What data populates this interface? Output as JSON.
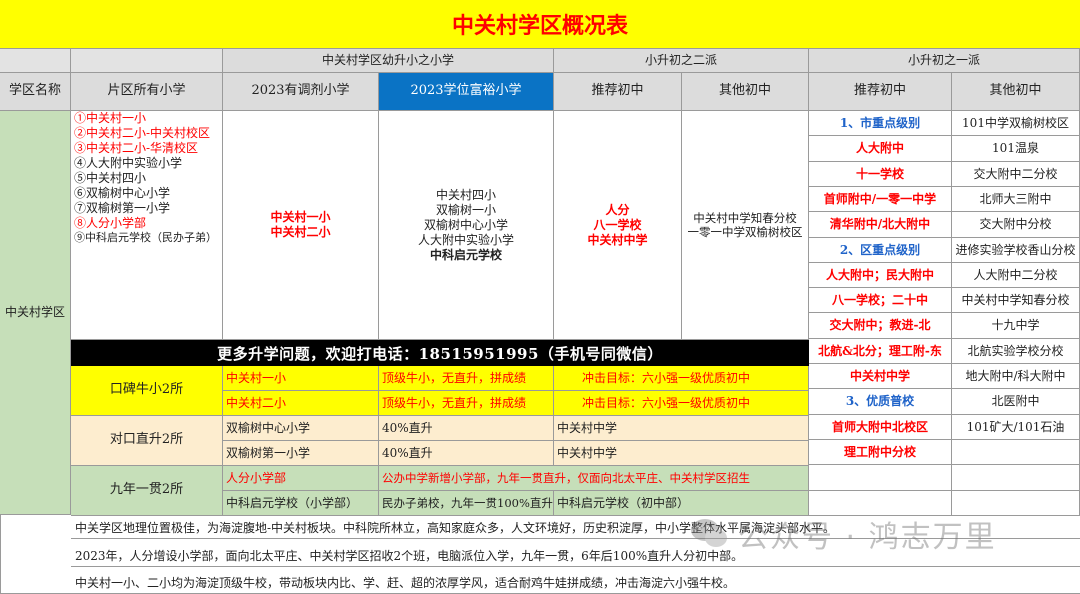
{
  "title": "中关村学区概况表",
  "headers": {
    "group_left": "中关村学区幼升小之小学",
    "group_mid": "小升初之二派",
    "group_right": "小升初之一派",
    "district_name": "学区名称",
    "all_schools": "片区所有小学",
    "adjust_2023": "2023有调剂小学",
    "rich_2023": "2023学位富裕小学",
    "rec_mid": "推荐初中",
    "other_mid": "其他初中",
    "rec_right": "推荐初中",
    "other_right": "其他初中"
  },
  "district": "中关村学区",
  "all_schools": [
    {
      "text": "①中关村一小",
      "red": true
    },
    {
      "text": "②中关村二小-中关村校区",
      "red": true
    },
    {
      "text": "③中关村二小-华清校区",
      "red": true
    },
    {
      "text": "④人大附中实验小学",
      "red": false
    },
    {
      "text": "⑤中关村四小",
      "red": false
    },
    {
      "text": "⑥双榆树中心小学",
      "red": false
    },
    {
      "text": "⑦双榆树第一小学",
      "red": false
    },
    {
      "text": "⑧人分小学部",
      "red": true
    },
    {
      "text": "⑨中科启元学校（民办子弟）",
      "red": false
    }
  ],
  "adjust_schools": [
    "中关村一小",
    "中关村二小"
  ],
  "rich_schools": [
    "中关村四小",
    "双榆树一小",
    "双榆树中心小学",
    "人大附中实验小学",
    "中科启元学校"
  ],
  "rec_mid": [
    "人分",
    "八一学校",
    "中关村中学"
  ],
  "other_mid": [
    "中关村中学知春分校",
    "一零一中学双榆树校区"
  ],
  "right_rows": [
    {
      "rec": "1、市重点级别",
      "rec_style": "blue",
      "other": "101中学双榆树校区"
    },
    {
      "rec": "人大附中",
      "rec_style": "red",
      "other": "101温泉"
    },
    {
      "rec": "十一学校",
      "rec_style": "red",
      "other": "交大附中二分校"
    },
    {
      "rec": "首师附中/一零一中学",
      "rec_style": "red",
      "other": "北师大三附中"
    },
    {
      "rec": "清华附中/北大附中",
      "rec_style": "red",
      "other": "交大附中分校"
    },
    {
      "rec": "2、区重点级别",
      "rec_style": "blue",
      "other": "进修实验学校香山分校"
    },
    {
      "rec": "人大附中；民大附中",
      "rec_style": "red",
      "other": "人大附中二分校"
    },
    {
      "rec": "八一学校；二十中",
      "rec_style": "red",
      "other": "中关村中学知春分校"
    },
    {
      "rec": "交大附中；教进-北",
      "rec_style": "red",
      "other": "十九中学"
    },
    {
      "rec": "北航&北分；理工附-东",
      "rec_style": "red",
      "other": "北航实验学校分校"
    },
    {
      "rec": "中关村中学",
      "rec_style": "red",
      "other": "地大附中/科大附中"
    },
    {
      "rec": "3、优质普校",
      "rec_style": "blue",
      "other": "北医附中"
    },
    {
      "rec": "首师大附中北校区",
      "rec_style": "red",
      "other": "101矿大/101石油"
    },
    {
      "rec": "理工附中分校",
      "rec_style": "red",
      "other": ""
    },
    {
      "rec": "",
      "rec_style": "red",
      "other": ""
    },
    {
      "rec": "",
      "rec_style": "red",
      "other": ""
    }
  ],
  "phone_banner": "更多升学问题，欢迎打电话：18515951995（手机号同微信）",
  "koubei": {
    "label": "口碑牛小2所",
    "rows": [
      {
        "school": "中关村一小",
        "desc": "顶级牛小，无直升，拼成绩",
        "target": "冲击目标：六小强一级优质初中"
      },
      {
        "school": "中关村二小",
        "desc": "顶级牛小，无直升，拼成绩",
        "target": "冲击目标：六小强一级优质初中"
      }
    ]
  },
  "duikou": {
    "label": "对口直升2所",
    "rows": [
      {
        "school": "双榆树中心小学",
        "rate": "40%直升",
        "mid": "中关村中学"
      },
      {
        "school": "双榆树第一小学",
        "rate": "40%直升",
        "mid": "中关村中学"
      }
    ]
  },
  "jiunian": {
    "label": "九年一贯2所",
    "row1_school": "人分小学部",
    "row1_desc": "公办中学新增小学部，九年一贯直升，仅面向北太平庄、中关村学区招生",
    "row2_school": "中科启元学校（小学部）",
    "row2_rate": "民办子弟校，九年一贯100%直升",
    "row2_mid": "中科启元学校（初中部）"
  },
  "notes": [
    "中关学区地理位置极佳，为海淀腹地-中关村板块。中科院所林立，高知家庭众多，人文环境好，历史积淀厚，中小学整体水平属海淀头部水平。",
    "2023年，人分增设小学部，面向北太平庄、中关村学区招收2个班，电脑派位入学，九年一贯，6年后100%直升人分初中部。",
    "中关村一小、二小均为海淀顶级牛校，带动板块内比、学、赶、超的浓厚学风，适合耐鸡牛娃拼成绩，冲击海淀六小强牛校。"
  ],
  "watermark": "公众号 · 鸿志万里"
}
